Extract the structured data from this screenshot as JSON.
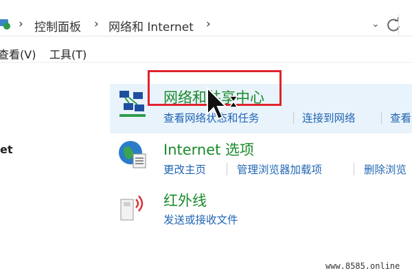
{
  "address_bar": {
    "breadcrumbs": [
      "控制面板",
      "网络和 Internet"
    ],
    "separator": "›",
    "dropdown": "⌄"
  },
  "menu_bar": {
    "view": "查看(V)",
    "tools": "工具(T)"
  },
  "left_pane": {
    "fragment": "et"
  },
  "items": [
    {
      "title": "网络和共享中心",
      "links": [
        "查看网络状态和任务",
        "连接到网络",
        "查看"
      ]
    },
    {
      "title": "Internet 选项",
      "links": [
        "更改主页",
        "管理浏览器加载项",
        "删除浏览"
      ]
    },
    {
      "title": "红外线",
      "links": [
        "发送或接收文件"
      ]
    }
  ],
  "colors": {
    "title_green": "#1a8a2a",
    "link_blue": "#2166b4",
    "highlight_bg": "#e9f3fb",
    "annotation_red": "#e0222b"
  },
  "icons": [
    "network-center-icon",
    "internet-options-icon",
    "infrared-icon",
    "refresh-icon"
  ],
  "watermark": "www.8585.online"
}
